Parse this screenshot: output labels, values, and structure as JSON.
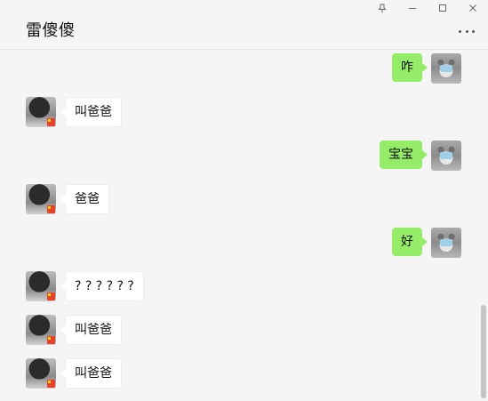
{
  "window": {
    "controls": [
      {
        "name": "pin-icon",
        "icon": "pin-icon"
      },
      {
        "name": "minimize-icon",
        "icon": "minimize-icon"
      },
      {
        "name": "maximize-icon",
        "icon": "maximize-icon"
      },
      {
        "name": "close-icon",
        "icon": "close-icon"
      }
    ]
  },
  "header": {
    "title": "雷傻傻",
    "more_icon": "more-icon"
  },
  "messages": [
    {
      "side": "right",
      "text": "咋"
    },
    {
      "side": "left",
      "text": "叫爸爸"
    },
    {
      "side": "right",
      "text": "宝宝"
    },
    {
      "side": "left",
      "text": "爸爸"
    },
    {
      "side": "right",
      "text": "好"
    },
    {
      "side": "left",
      "text": "? ? ? ? ? ?"
    },
    {
      "side": "left",
      "text": "叫爸爸"
    },
    {
      "side": "left",
      "text": "叫爸爸"
    }
  ],
  "colors": {
    "my_bubble": "#95ec69",
    "peer_bubble": "#ffffff",
    "background": "#f5f5f5"
  }
}
